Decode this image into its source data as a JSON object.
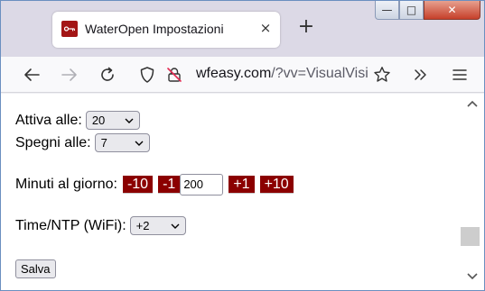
{
  "browser": {
    "tab_title": "WaterOpen Impostazioni",
    "tab_close": "×",
    "new_tab": "+",
    "url_host": "wfeasy.com",
    "url_rest": "/?vv=VisualVisi"
  },
  "window_controls": {
    "minimize": "—",
    "maximize": "□",
    "close": "✕"
  },
  "settings": {
    "attiva_label": "Attiva alle:",
    "attiva_value": "20",
    "spegni_label": "Spegni alle:",
    "spegni_value": "7",
    "minuti_label": "Minuti al giorno:",
    "minus10": "-10",
    "minus1": "-1",
    "minuti_value": "200",
    "plus1": "+1",
    "plus10": "+10",
    "ntp_label": "Time/NTP (WiFi):",
    "ntp_value": "+2",
    "save_label": "Salva"
  },
  "colors": {
    "step_button_bg": "#8b0000",
    "favicon_bg": "#a31515"
  },
  "icons": [
    "back-arrow-icon",
    "forward-arrow-icon",
    "reload-icon",
    "shield-icon",
    "permissions-blocked-icon",
    "bookmark-star-icon",
    "overflow-chevrons-icon",
    "menu-icon"
  ]
}
